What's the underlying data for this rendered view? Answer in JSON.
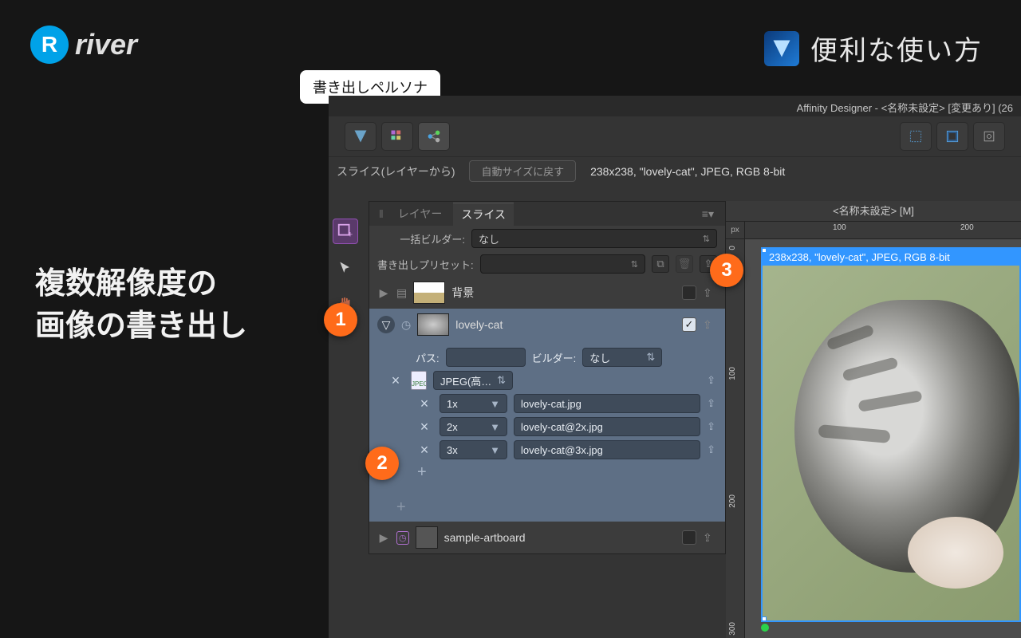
{
  "brand": {
    "icon_text": "R",
    "name": "river"
  },
  "page": {
    "title": "便利な使い方",
    "app_icon": "A"
  },
  "headline_line1": "複数解像度の",
  "headline_line2": "画像の書き出し",
  "tooltip": "書き出しペルソナ",
  "window_title": "Affinity Designer - <名称未設定> [変更あり] (26",
  "subtoolbar": {
    "label": "スライス(レイヤーから)",
    "reset_btn": "自動サイズに戻す",
    "info": "238x238, \"lovely-cat\", JPEG, RGB 8-bit"
  },
  "panel": {
    "tab_layers": "レイヤー",
    "tab_slices": "スライス",
    "builder_label": "一括ビルダー:",
    "builder_value": "なし",
    "preset_label": "書き出しプリセット:",
    "preset_value": ""
  },
  "slices": {
    "bg_name": "背景",
    "cat_name": "lovely-cat",
    "artboard_name": "sample-artboard",
    "path_label": "パス:",
    "builder_label": "ビルダー:",
    "builder_value": "なし",
    "format": "JPEG(高…",
    "outputs": [
      {
        "scale": "1x",
        "file": "lovely-cat.jpg"
      },
      {
        "scale": "2x",
        "file": "lovely-cat@2x.jpg"
      },
      {
        "scale": "3x",
        "file": "lovely-cat@3x.jpg"
      }
    ]
  },
  "canvas": {
    "doc_tab": "<名称未設定> [M]",
    "unit": "px",
    "ruler_h": [
      "100",
      "200"
    ],
    "ruler_v": [
      "0",
      "100",
      "200",
      "300"
    ],
    "slice_label": "238x238, \"lovely-cat\", JPEG, RGB 8-bit"
  },
  "callouts": {
    "c1": "1",
    "c2": "2",
    "c3": "3"
  }
}
